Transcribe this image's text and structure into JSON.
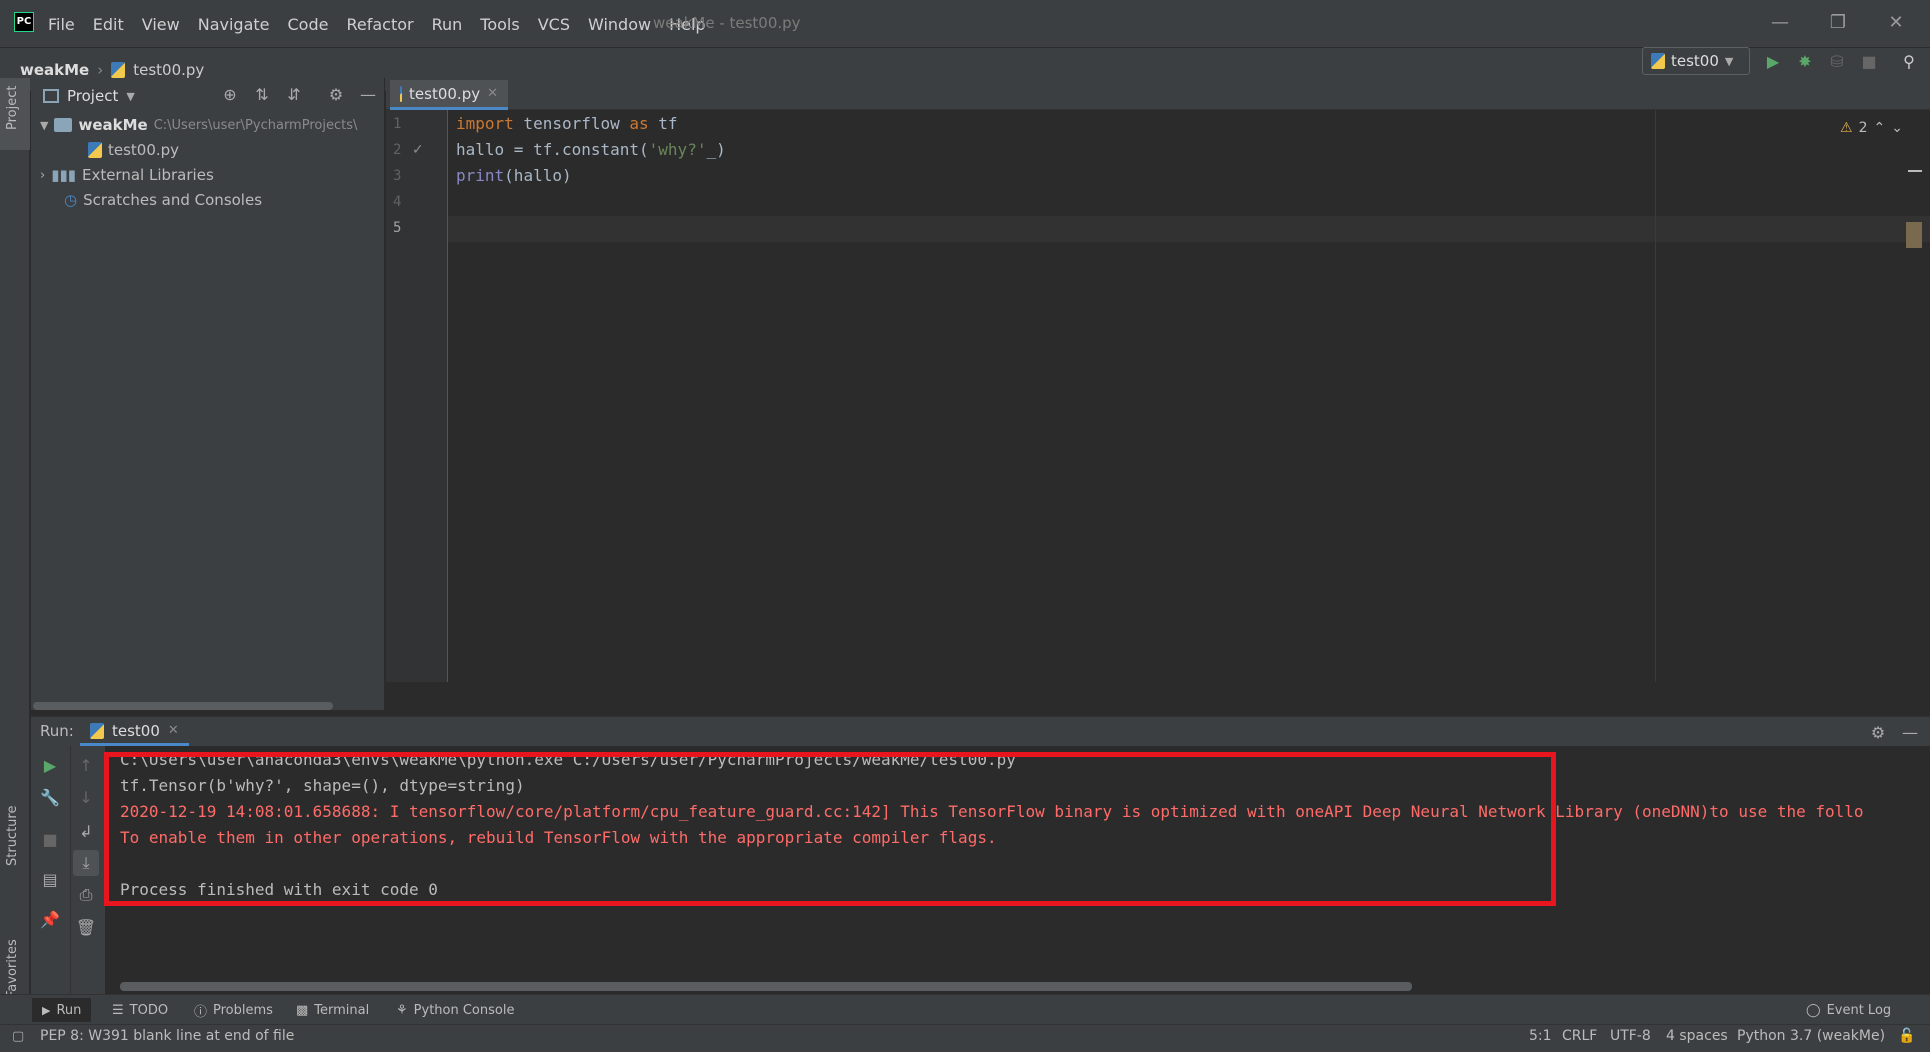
{
  "window": {
    "title": "weakMe - test00.py",
    "menu": [
      "File",
      "Edit",
      "View",
      "Navigate",
      "Code",
      "Refactor",
      "Run",
      "Tools",
      "VCS",
      "Window",
      "Help"
    ],
    "minimize_icon": "minimize-icon",
    "restore_icon": "restore-icon",
    "close_icon": "close-icon",
    "logo_text": "PC"
  },
  "navbar": {
    "project": "weakMe",
    "file": "test00.py",
    "run_config": "test00"
  },
  "left_stripe": {
    "top_tab": "Project",
    "structure_tab": "Structure",
    "favorites_tab": "Favorites"
  },
  "project_panel": {
    "title": "Project",
    "root_name": "weakMe",
    "root_path": "C:\\Users\\user\\PycharmProjects\\",
    "items": [
      {
        "label": "test00.py"
      },
      {
        "label": "External Libraries"
      },
      {
        "label": "Scratches and Consoles"
      }
    ]
  },
  "editor": {
    "tab": "test00.py",
    "line_numbers": [
      "1",
      "2",
      "3",
      "4",
      "5"
    ],
    "lines": [
      {
        "kw1": "import",
        "a": " tensorflow ",
        "kw2": "as",
        "b": " tf"
      },
      {
        "a": "hallo = tf.constant(",
        "str": "'why?'",
        "b": "_)"
      },
      {
        "bi": "print",
        "a": "(hallo)"
      }
    ],
    "warnings_count": "2"
  },
  "run": {
    "label": "Run:",
    "tab": "test00",
    "console": [
      {
        "text": "C:\\Users\\user\\anaconda3\\envs\\weakMe\\python.exe C:/Users/user/PycharmProjects/weakMe/test00.py",
        "type": "normal"
      },
      {
        "text": "tf.Tensor(b'why?', shape=(), dtype=string)",
        "type": "normal"
      },
      {
        "text": "2020-12-19 14:08:01.658688: I tensorflow/core/platform/cpu_feature_guard.cc:142] This TensorFlow binary is optimized with oneAPI Deep Neural Network Library (oneDNN)to use the follo",
        "type": "error"
      },
      {
        "text": "To enable them in other operations, rebuild TensorFlow with the appropriate compiler flags.",
        "type": "error"
      },
      {
        "text": "",
        "type": "normal"
      },
      {
        "text": "Process finished with exit code 0",
        "type": "normal"
      }
    ]
  },
  "bottom_tabs": {
    "run": "Run",
    "todo": "TODO",
    "problems": "Problems",
    "terminal": "Terminal",
    "python_console": "Python Console",
    "event_log": "Event Log"
  },
  "status": {
    "message": "PEP 8: W391 blank line at end of file",
    "position": "5:1",
    "line_sep": "CRLF",
    "encoding": "UTF-8",
    "indent": "4 spaces",
    "interpreter": "Python 3.7 (weakMe)"
  },
  "colors": {
    "accent": "#4a88c7",
    "run_green": "#59a869",
    "error_red": "#ff6b68",
    "highlight_box": "#e8141e"
  }
}
